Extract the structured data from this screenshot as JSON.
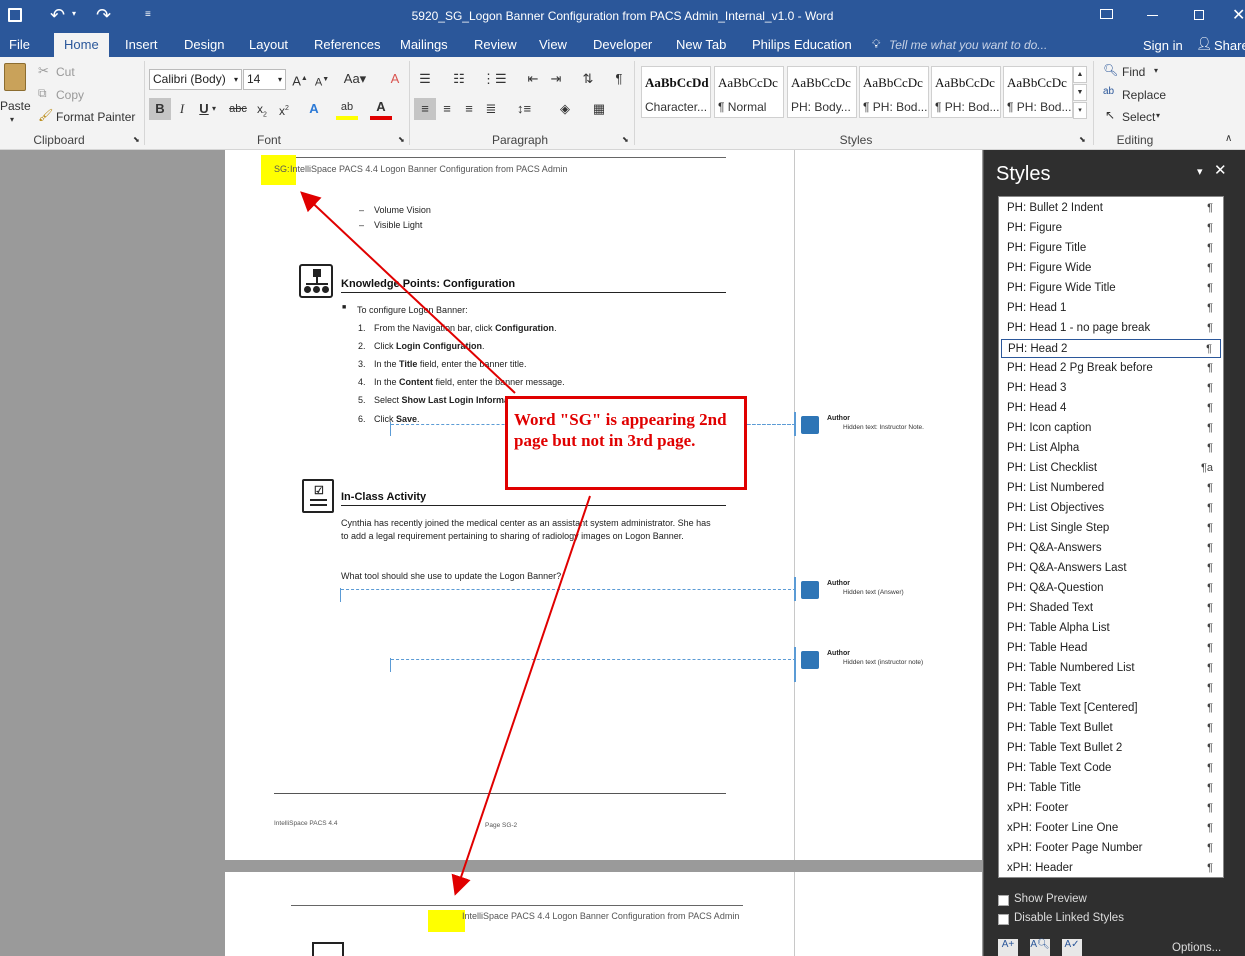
{
  "window": {
    "title": "5920_SG_Logon Banner Configuration from PACS Admin_Internal_v1.0  -  Word"
  },
  "tabs": [
    "File",
    "Home",
    "Insert",
    "Design",
    "Layout",
    "References",
    "Mailings",
    "Review",
    "View",
    "Developer",
    "New Tab",
    "Philips Education"
  ],
  "tell_me": "Tell me what you want to do...",
  "account": {
    "sign_in": "Sign in",
    "share": "Share"
  },
  "clipboard": {
    "paste": "Paste",
    "cut": "Cut",
    "copy": "Copy",
    "format_painter": "Format Painter",
    "label": "Clipboard"
  },
  "font": {
    "name": "Calibri (Body)",
    "size": "14",
    "label": "Font"
  },
  "paragraph": {
    "label": "Paragraph"
  },
  "styles_gallery": {
    "label": "Styles",
    "items": [
      {
        "preview": "AaBbCcDd",
        "name": "Character..."
      },
      {
        "preview": "AaBbCcDc",
        "name": "¶ Normal"
      },
      {
        "preview": "AaBbCcDc",
        "name": "PH: Body..."
      },
      {
        "preview": "AaBbCcDc",
        "name": "¶ PH: Bod..."
      },
      {
        "preview": "AaBbCcDc",
        "name": "¶ PH: Bod..."
      },
      {
        "preview": "AaBbCcDc",
        "name": "¶ PH: Bod..."
      }
    ]
  },
  "editing": {
    "find": "Find",
    "replace": "Replace",
    "select": "Select",
    "label": "Editing"
  },
  "document": {
    "header1": {
      "prefix": "SG: ",
      "title": "IntelliSpace PACS 4.4 Logon Banner Configuration from PACS Admin"
    },
    "bullets": [
      "Volume Vision",
      "Visible Light"
    ],
    "kp_heading": "Knowledge Points: Configuration",
    "kp_intro": "To configure Logon Banner:",
    "steps": [
      {
        "n": "1.",
        "pre": "From the Navigation bar, click ",
        "b": "Configuration",
        "post": "."
      },
      {
        "n": "2.",
        "pre": " Click ",
        "b": "Login Configuration",
        "post": "."
      },
      {
        "n": "3.",
        "pre": "In the ",
        "b": "Title",
        "post": " field, enter the banner title."
      },
      {
        "n": "4.",
        "pre": "In the ",
        "b": "Content",
        "post": " field, enter the banner message."
      },
      {
        "n": "5.",
        "pre": "Select ",
        "b": "Show Last Login Informa",
        "post": ""
      },
      {
        "n": "6.",
        "pre": "Click ",
        "b": "Save",
        "post": "."
      }
    ],
    "activity_heading": "In-Class Activity",
    "activity_text1": "Cynthia has recently joined the medical center as an assistant system administrator. She has",
    "activity_text2": "to add a legal requirement pertaining to sharing of radiology images on Logon Banner.",
    "question": "What tool should she use to update the Logon Banner?",
    "footer_left": "IntelliSpace PACS 4.4",
    "footer_page": "Page SG-2",
    "header2": "IntelliSpace PACS 4.4 Logon Banner Configuration from PACS Admin"
  },
  "comments": [
    {
      "author": "Author",
      "text": "Hidden text: Instructor Note."
    },
    {
      "author": "Author",
      "text": "Hidden text (Answer)"
    },
    {
      "author": "Author",
      "text": "Hidden text (instructor note)"
    }
  ],
  "annotation": {
    "text": "Word \"SG\" is appearing 2nd page but not in 3rd page.",
    "color": "#e00000"
  },
  "styles_pane": {
    "title": "Styles",
    "items": [
      {
        "name": "PH: Bullet 2 Indent",
        "mark": "¶"
      },
      {
        "name": "PH: Figure",
        "mark": "¶"
      },
      {
        "name": "PH: Figure Title",
        "mark": "¶"
      },
      {
        "name": "PH: Figure Wide",
        "mark": "¶"
      },
      {
        "name": "PH: Figure Wide Title",
        "mark": "¶"
      },
      {
        "name": "PH: Head 1",
        "mark": "¶"
      },
      {
        "name": "PH: Head 1 - no page break",
        "mark": "¶"
      },
      {
        "name": "PH: Head 2",
        "mark": "¶"
      },
      {
        "name": "PH: Head 2 Pg Break before",
        "mark": "¶"
      },
      {
        "name": "PH: Head 3",
        "mark": "¶"
      },
      {
        "name": "PH: Head 4",
        "mark": "¶"
      },
      {
        "name": "PH: Icon caption",
        "mark": "¶"
      },
      {
        "name": "PH: List Alpha",
        "mark": "¶"
      },
      {
        "name": "PH: List Checklist",
        "mark": "¶a"
      },
      {
        "name": "PH: List Numbered",
        "mark": "¶"
      },
      {
        "name": "PH: List Objectives",
        "mark": "¶"
      },
      {
        "name": "PH: List Single Step",
        "mark": "¶"
      },
      {
        "name": "PH: Q&A-Answers",
        "mark": "¶"
      },
      {
        "name": "PH: Q&A-Answers Last",
        "mark": "¶"
      },
      {
        "name": "PH: Q&A-Question",
        "mark": "¶"
      },
      {
        "name": "PH: Shaded Text",
        "mark": "¶"
      },
      {
        "name": "PH: Table Alpha List",
        "mark": "¶"
      },
      {
        "name": "PH: Table Head",
        "mark": "¶"
      },
      {
        "name": "PH: Table Numbered List",
        "mark": "¶"
      },
      {
        "name": "PH: Table Text",
        "mark": "¶"
      },
      {
        "name": "PH: Table Text [Centered]",
        "mark": "¶"
      },
      {
        "name": "PH: Table Text Bullet",
        "mark": "¶"
      },
      {
        "name": "PH: Table Text Bullet 2",
        "mark": "¶"
      },
      {
        "name": "PH: Table Text Code",
        "mark": "¶"
      },
      {
        "name": "PH: Table Title",
        "mark": "¶"
      },
      {
        "name": "xPH: Footer",
        "mark": "¶"
      },
      {
        "name": "xPH: Footer Line One",
        "mark": "¶"
      },
      {
        "name": "xPH: Footer Page Number",
        "mark": "¶"
      },
      {
        "name": "xPH: Header",
        "mark": "¶"
      }
    ],
    "selected": "PH: Head 2",
    "show_preview": "Show Preview",
    "disable_linked": "Disable Linked Styles",
    "options": "Options..."
  },
  "colors": {
    "word_blue": "#2b579a",
    "highlight": "#ffff00",
    "arrow": "#e00000"
  }
}
